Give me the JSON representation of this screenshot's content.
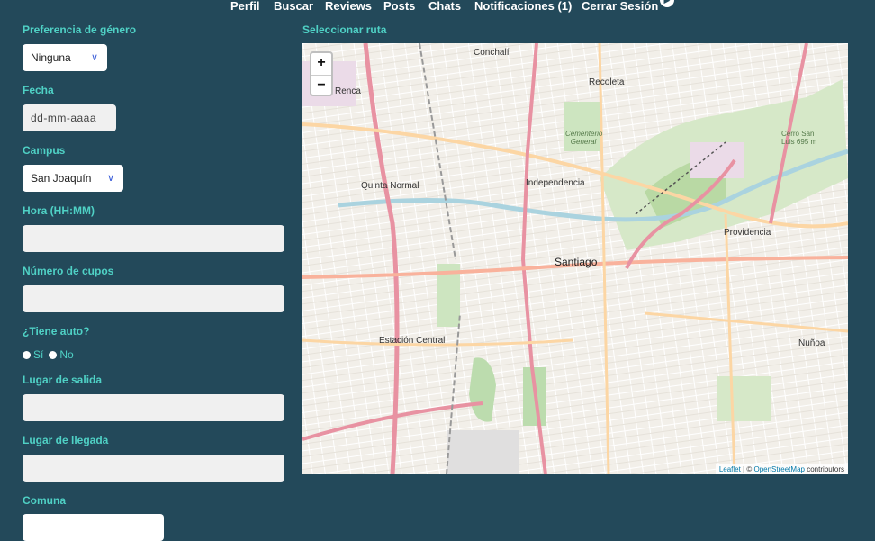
{
  "nav": {
    "items": [
      "Perfil",
      "Buscar",
      "Reviews",
      "Posts",
      "Chats",
      "Notificaciones (1)",
      "Cerrar Sesión"
    ]
  },
  "form": {
    "genero_label": "Preferencia de género",
    "genero_value": "Ninguna",
    "fecha_label": "Fecha",
    "fecha_placeholder": "dd-mm-aaaa",
    "campus_label": "Campus",
    "campus_value": "San Joaquín",
    "hora_label": "Hora (HH:MM)",
    "cupos_label": "Número de cupos",
    "auto_label": "¿Tiene auto?",
    "auto_si": "Sí",
    "auto_no": "No",
    "salida_label": "Lugar de salida",
    "llegada_label": "Lugar de llegada",
    "comuna_label": "Comuna"
  },
  "map": {
    "title": "Seleccionar ruta",
    "zoom_in": "+",
    "zoom_out": "−",
    "attribution_leaflet": "Leaflet",
    "attribution_sep": " | © ",
    "attribution_osm": "OpenStreetMap",
    "attribution_contrib": " contributors",
    "labels": {
      "conchali": "Conchalí",
      "recoleta": "Recoleta",
      "renca": "Renca",
      "quinta_normal": "Quinta Normal",
      "independencia": "Independencia",
      "santiago": "Santiago",
      "providencia": "Providencia",
      "estacion_central": "Estación Central",
      "nunoa": "Ñuñoa",
      "cementerio": "Cementerio General",
      "cerro": "Cerro San Luis 695 m"
    }
  }
}
